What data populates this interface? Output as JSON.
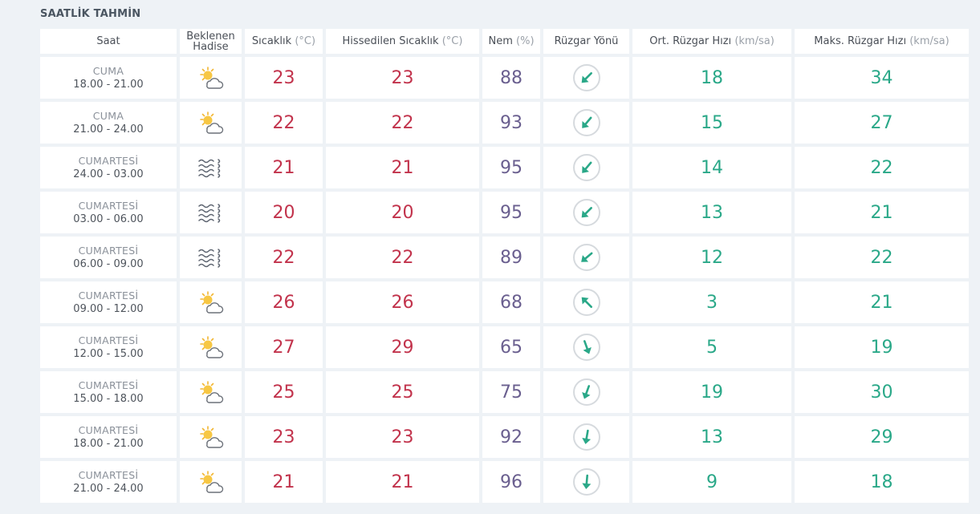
{
  "title": "SAATLİK TAHMİN",
  "headers": {
    "saat": "Saat",
    "hadise_line1": "Beklenen",
    "hadise_line2": "Hadise",
    "sicaklik": "Sıcaklık",
    "sicaklik_unit": "(°C)",
    "hissedilen": "Hissedilen Sıcaklık",
    "hissedilen_unit": "(°C)",
    "nem": "Nem",
    "nem_unit": "(%)",
    "ruzgar_yonu": "Rüzgar Yönü",
    "ort_ruzgar": "Ort. Rüzgar Hızı",
    "ort_ruzgar_unit": "(km/sa)",
    "maks_ruzgar": "Maks. Rüzgar Hızı",
    "maks_ruzgar_unit": "(km/sa)"
  },
  "colors": {
    "temperature": "#c2334c",
    "humidity": "#6a5f8f",
    "wind": "#2aa888"
  },
  "rows": [
    {
      "day": "CUMA",
      "time": "18.00 - 21.00",
      "icon": "partly-cloudy-icon",
      "temp": "23",
      "feels": "23",
      "humidity": "88",
      "wind_dir_deg": 225,
      "wind_avg": "18",
      "wind_max": "34"
    },
    {
      "day": "CUMA",
      "time": "21.00 - 24.00",
      "icon": "partly-cloudy-icon",
      "temp": "22",
      "feels": "22",
      "humidity": "93",
      "wind_dir_deg": 220,
      "wind_avg": "15",
      "wind_max": "27"
    },
    {
      "day": "CUMARTESİ",
      "time": "24.00 - 03.00",
      "icon": "fog-icon",
      "temp": "21",
      "feels": "21",
      "humidity": "95",
      "wind_dir_deg": 220,
      "wind_avg": "14",
      "wind_max": "22"
    },
    {
      "day": "CUMARTESİ",
      "time": "03.00 - 06.00",
      "icon": "fog-icon",
      "temp": "20",
      "feels": "20",
      "humidity": "95",
      "wind_dir_deg": 225,
      "wind_avg": "13",
      "wind_max": "21"
    },
    {
      "day": "CUMARTESİ",
      "time": "06.00 - 09.00",
      "icon": "fog-icon",
      "temp": "22",
      "feels": "22",
      "humidity": "89",
      "wind_dir_deg": 230,
      "wind_avg": "12",
      "wind_max": "22"
    },
    {
      "day": "CUMARTESİ",
      "time": "09.00 - 12.00",
      "icon": "partly-cloudy-icon",
      "temp": "26",
      "feels": "26",
      "humidity": "68",
      "wind_dir_deg": 315,
      "wind_avg": "3",
      "wind_max": "21"
    },
    {
      "day": "CUMARTESİ",
      "time": "12.00 - 15.00",
      "icon": "partly-cloudy-icon",
      "temp": "27",
      "feels": "29",
      "humidity": "65",
      "wind_dir_deg": 160,
      "wind_avg": "5",
      "wind_max": "19"
    },
    {
      "day": "CUMARTESİ",
      "time": "15.00 - 18.00",
      "icon": "partly-cloudy-icon",
      "temp": "25",
      "feels": "25",
      "humidity": "75",
      "wind_dir_deg": 200,
      "wind_avg": "19",
      "wind_max": "30"
    },
    {
      "day": "CUMARTESİ",
      "time": "18.00 - 21.00",
      "icon": "partly-cloudy-icon",
      "temp": "23",
      "feels": "23",
      "humidity": "92",
      "wind_dir_deg": 190,
      "wind_avg": "13",
      "wind_max": "29"
    },
    {
      "day": "CUMARTESİ",
      "time": "21.00 - 24.00",
      "icon": "partly-cloudy-icon",
      "temp": "21",
      "feels": "21",
      "humidity": "96",
      "wind_dir_deg": 185,
      "wind_avg": "9",
      "wind_max": "18"
    }
  ]
}
